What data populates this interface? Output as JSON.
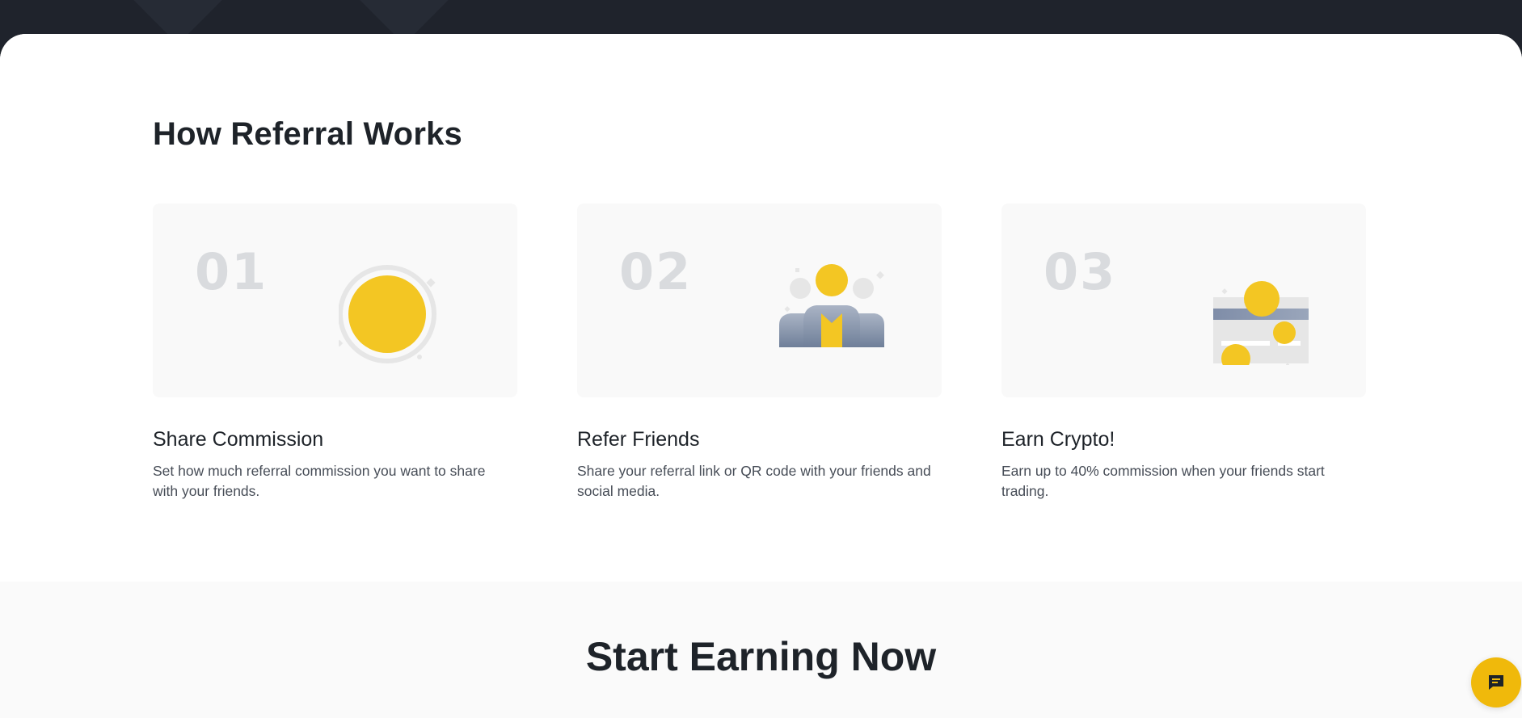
{
  "how_referral": {
    "title": "How Referral Works",
    "steps": [
      {
        "number": "01",
        "title": "Share Commission",
        "description": "Set how much referral commission you want to share with your friends.",
        "icon": "coin-icon"
      },
      {
        "number": "02",
        "title": "Refer Friends",
        "description": "Share your referral link or QR code with your friends and social media.",
        "icon": "friends-icon"
      },
      {
        "number": "03",
        "title": "Earn Crypto!",
        "description": "Earn up to 40% commission when your friends start trading.",
        "icon": "card-coins-icon"
      }
    ]
  },
  "start_earning": {
    "title": "Start Earning Now"
  },
  "chat": {
    "icon": "chat-bubble-icon"
  },
  "colors": {
    "accent": "#f0b90b",
    "coin_yellow": "#f3c623",
    "dark": "#1e2329",
    "card_bg": "#f9f9f9",
    "number_gray": "#d9dbde",
    "text_secondary": "#474d57"
  }
}
